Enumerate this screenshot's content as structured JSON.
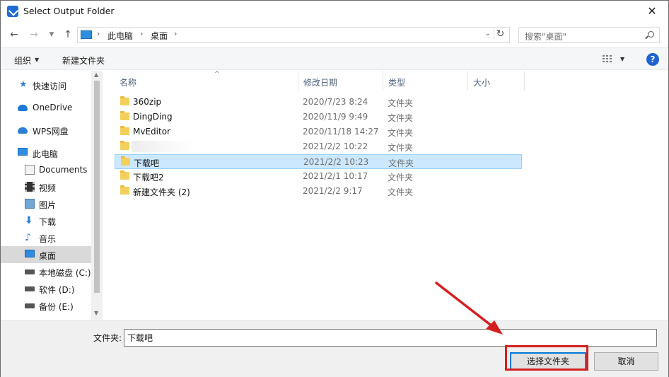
{
  "window": {
    "title": "Select Output Folder",
    "close": "✕"
  },
  "address": {
    "crumbs": [
      "此电脑",
      "桌面"
    ],
    "search_placeholder": "搜索\"桌面\""
  },
  "toolbar": {
    "organize": "组织",
    "new_folder": "新建文件夹"
  },
  "help": "?",
  "nav": {
    "items": [
      {
        "label": "快速访问",
        "icon": "star-icon"
      },
      {
        "label": "OneDrive",
        "icon": "cloud-icon"
      },
      {
        "label": "WPS网盘",
        "icon": "cloud-icon"
      },
      {
        "label": "此电脑",
        "icon": "computer-icon"
      },
      {
        "label": "Documents",
        "icon": "document-icon"
      },
      {
        "label": "视频",
        "icon": "video-icon"
      },
      {
        "label": "图片",
        "icon": "picture-icon"
      },
      {
        "label": "下载",
        "icon": "download-icon"
      },
      {
        "label": "音乐",
        "icon": "music-icon"
      },
      {
        "label": "桌面",
        "icon": "desktop-icon",
        "selected": true
      },
      {
        "label": "本地磁盘 (C:)",
        "icon": "drive-icon"
      },
      {
        "label": "软件 (D:)",
        "icon": "drive-icon"
      },
      {
        "label": "备份 (E:)",
        "icon": "drive-icon"
      }
    ]
  },
  "columns": {
    "name": "名称",
    "modified": "修改日期",
    "type": "类型",
    "size": "大小"
  },
  "files": [
    {
      "name": "360zip",
      "date": "2020/7/23 8:24",
      "type": "文件夹"
    },
    {
      "name": "DingDing",
      "date": "2020/11/9 9:49",
      "type": "文件夹"
    },
    {
      "name": "MvEditor",
      "date": "2020/11/18 14:27",
      "type": "文件夹"
    },
    {
      "name": "",
      "date": "2021/2/2 10:22",
      "type": "文件夹"
    },
    {
      "name": "下载吧",
      "date": "2021/2/2 10:23",
      "type": "文件夹",
      "selected": true
    },
    {
      "name": "下载吧2",
      "date": "2021/2/1 10:17",
      "type": "文件夹"
    },
    {
      "name": "新建文件夹 (2)",
      "date": "2021/2/2 9:17",
      "type": "文件夹"
    }
  ],
  "footer": {
    "folder_label": "文件夹:",
    "folder_value": "下载吧",
    "select_button": "选择文件夹",
    "cancel_button": "取消"
  },
  "colors": {
    "accent": "#0078d7",
    "selection": "#cce8ff",
    "annotation": "#d41f1f"
  }
}
